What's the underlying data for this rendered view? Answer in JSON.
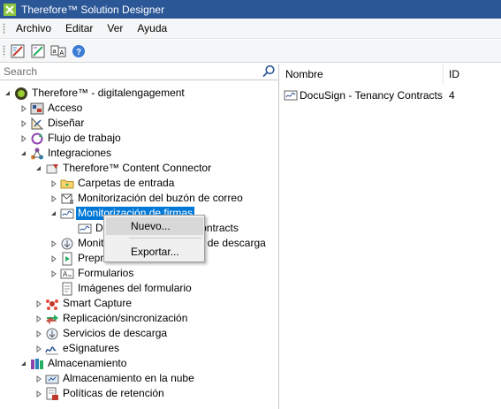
{
  "window": {
    "title": "Therefore™ Solution Designer"
  },
  "menubar": {
    "items": [
      "Archivo",
      "Editar",
      "Ver",
      "Ayuda"
    ]
  },
  "search": {
    "placeholder": "Search"
  },
  "tree": {
    "root": "Therefore™ -  digitalengagement",
    "acceso": "Acceso",
    "disenar": "Diseñar",
    "flujo": "Flujo de trabajo",
    "integraciones": "Integraciones",
    "content_connector": "Therefore™ Content Connector",
    "carpetas": "Carpetas de entrada",
    "buzon": "Monitorización del buzón de correo",
    "firmas": "Monitorización de firmas",
    "firmas_child": "DocuSign - Tenancy Contracts",
    "descarga": "Monitorización de carpetas de descarga",
    "preprocesado": "Preprocesado",
    "formularios": "Formularios",
    "imagenes": "Imágenes del formulario",
    "smart_capture": "Smart Capture",
    "replicacion": "Replicación/sincronización",
    "servicios": "Servicios de descarga",
    "esignatures": "eSignatures",
    "almacenamiento": "Almacenamiento",
    "nube": "Almacenamiento en la nube",
    "retencion": "Políticas de retención"
  },
  "list": {
    "headers": {
      "name": "Nombre",
      "id": "ID"
    },
    "rows": [
      {
        "name": "DocuSign - Tenancy Contracts",
        "id": "4"
      }
    ]
  },
  "context_menu": {
    "new": "Nuevo...",
    "export": "Exportar..."
  },
  "colors": {
    "titlebar": "#2b5797",
    "selection": "#0078d7",
    "toolbar": "#f5f6f7"
  }
}
